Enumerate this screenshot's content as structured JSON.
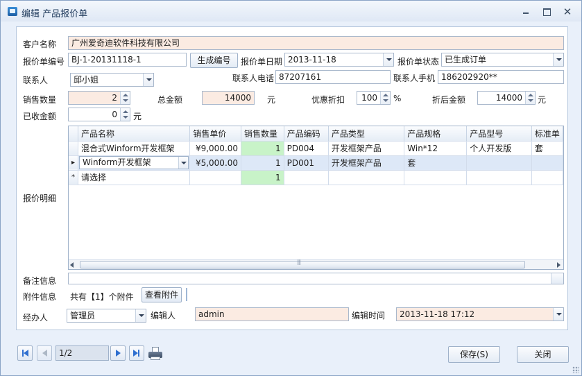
{
  "window": {
    "title": "编辑 产品报价单"
  },
  "form": {
    "customer_label": "客户名称",
    "customer_value": "广州爱奇迪软件科技有限公司",
    "quote_no_label": "报价单编号",
    "quote_no_value": "BJ-1-20131118-1",
    "gen_no_button": "生成编号",
    "quote_date_label": "报价单日期",
    "quote_date_value": "2013-11-18",
    "quote_status_label": "报价单状态",
    "quote_status_value": "已生成订单",
    "contact_label": "联系人",
    "contact_value": "邱小姐",
    "contact_phone_label": "联系人电话",
    "contact_phone_value": "87207161",
    "contact_mobile_label": "联系人手机",
    "contact_mobile_value": "186202920**",
    "qty_label": "销售数量",
    "qty_value": "2",
    "total_label": "总金额",
    "total_value": "14000",
    "total_unit": "元",
    "discount_label": "优惠折扣",
    "discount_value": "100",
    "discount_unit": "%",
    "after_discount_label": "折后金额",
    "after_discount_value": "14000",
    "after_discount_unit": "元",
    "received_label": "已收金额",
    "received_value": "0",
    "received_unit": "元",
    "detail_label": "报价明细",
    "remark_label": "备注信息",
    "attachment_label": "附件信息",
    "attachment_text": "共有【1】个附件",
    "view_attachment_button": "查看附件",
    "handler_label": "经办人",
    "handler_value": "管理员",
    "editor_label": "编辑人",
    "editor_value": "admin",
    "edit_time_label": "编辑时间",
    "edit_time_value": "2013-11-18 17:12"
  },
  "grid": {
    "columns": [
      "产品名称",
      "销售单价",
      "销售数量",
      "产品编码",
      "产品类型",
      "产品规格",
      "产品型号",
      "标准单"
    ],
    "rows": [
      {
        "indicator": "",
        "name": "混合式Winform开发框架",
        "price": "¥9,000.00",
        "qty": "1",
        "code": "PD004",
        "type": "开发框架产品",
        "spec": "Win*12",
        "model": "个人开发版",
        "unit": "套"
      },
      {
        "indicator": "▸",
        "name": "Winform开发框架",
        "price": "¥5,000.00",
        "qty": "1",
        "code": "PD001",
        "type": "开发框架产品",
        "spec": "套",
        "model": "",
        "unit": ""
      },
      {
        "indicator": "*",
        "name": "请选择",
        "price": "",
        "qty": "1",
        "code": "",
        "type": "",
        "spec": "",
        "model": "",
        "unit": ""
      }
    ]
  },
  "footer": {
    "pager_value": "1/2",
    "save_button": "保存(S)",
    "close_button": "关闭"
  },
  "colors": {
    "window_bg": "#e9f0fa",
    "readonly_field_bg": "#fbebe2",
    "qty_cell_bg": "#c8f3c8",
    "selected_row_bg": "#dde8f7"
  }
}
